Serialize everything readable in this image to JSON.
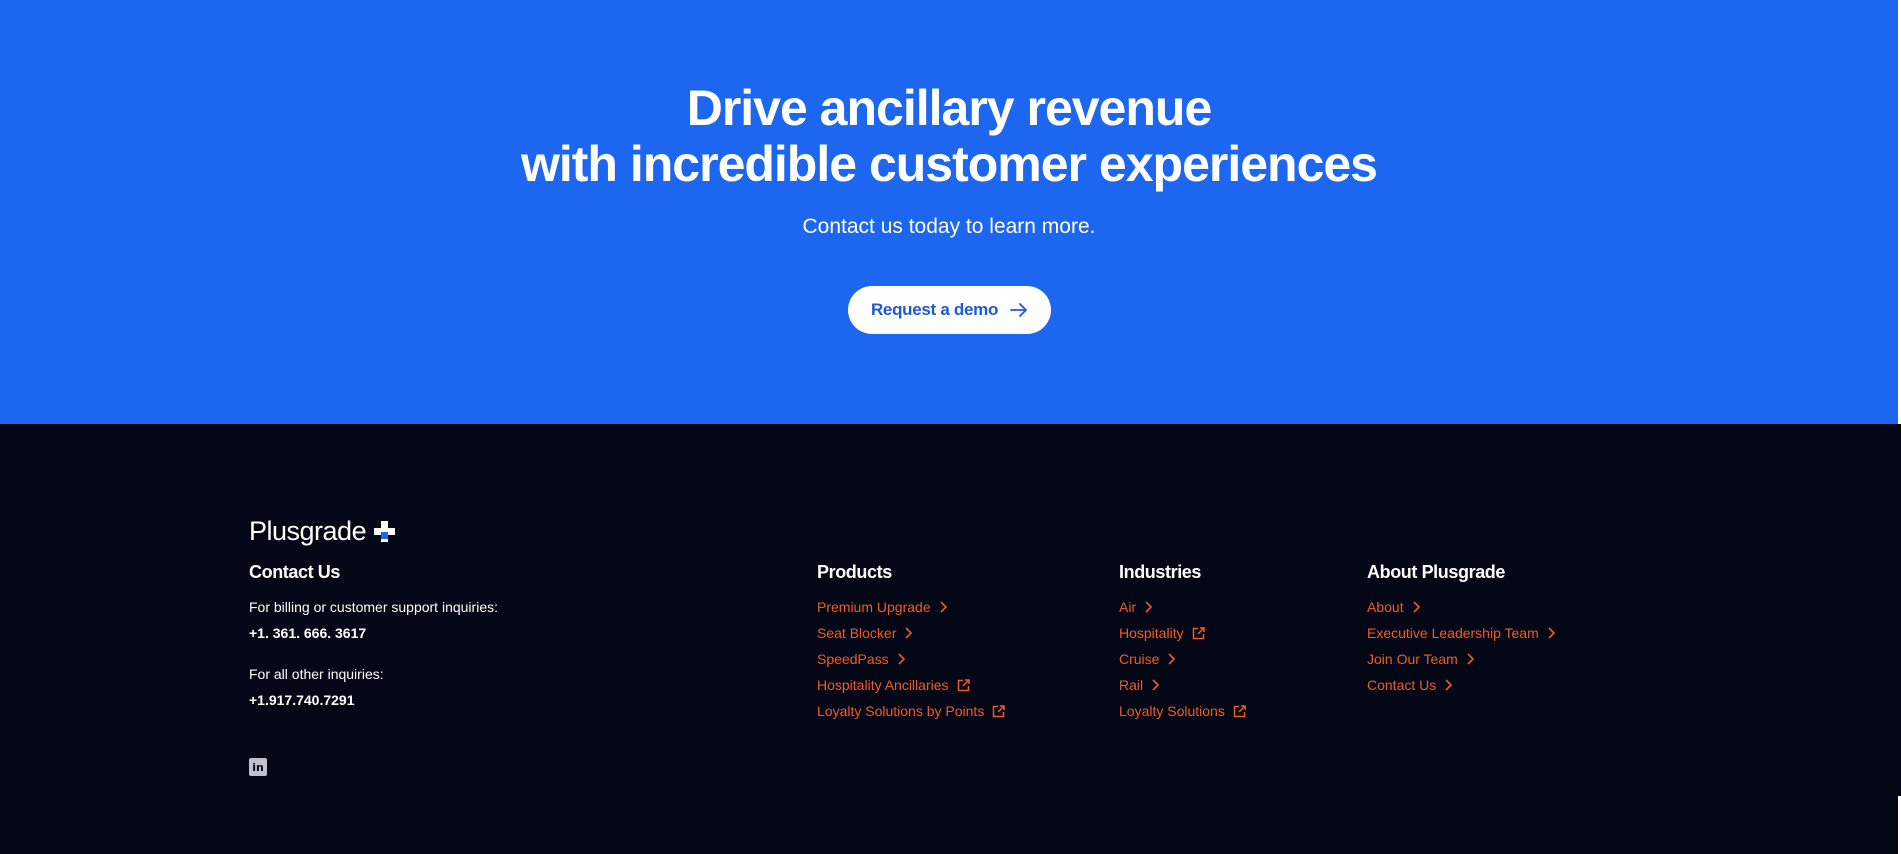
{
  "hero": {
    "title_line1": "Drive ancillary revenue",
    "title_line2": "with incredible customer experiences",
    "subtitle": "Contact us today to learn more.",
    "cta_label": "Request a demo",
    "cta_icon": "arrow-right-icon",
    "bg_color": "#1c66f0"
  },
  "footer": {
    "bg_color": "#040715",
    "link_color": "#f05a28",
    "logo_text": "Plusgrade",
    "contact": {
      "heading": "Contact Us",
      "billing_label": "For billing or customer support inquiries:",
      "billing_phone": "+1. 361. 666. 3617",
      "other_label": "For all other inquiries:",
      "other_phone": "+1.917.740.7291"
    },
    "social_icon": "linkedin-icon",
    "products": {
      "heading": "Products",
      "items": [
        {
          "label": "Premium Upgrade",
          "icon": "chevron-right-icon"
        },
        {
          "label": "Seat Blocker",
          "icon": "chevron-right-icon"
        },
        {
          "label": "SpeedPass",
          "icon": "chevron-right-icon"
        },
        {
          "label": "Hospitality Ancillaries",
          "icon": "external-link-icon"
        },
        {
          "label": "Loyalty Solutions by Points",
          "icon": "external-link-icon"
        }
      ]
    },
    "industries": {
      "heading": "Industries",
      "items": [
        {
          "label": "Air",
          "icon": "chevron-right-icon"
        },
        {
          "label": "Hospitality",
          "icon": "external-link-icon"
        },
        {
          "label": "Cruise",
          "icon": "chevron-right-icon"
        },
        {
          "label": "Rail",
          "icon": "chevron-right-icon"
        },
        {
          "label": "Loyalty Solutions",
          "icon": "external-link-icon"
        }
      ]
    },
    "about": {
      "heading": "About Plusgrade",
      "items": [
        {
          "label": "About",
          "icon": "chevron-right-icon"
        },
        {
          "label": "Executive Leadership Team",
          "icon": "chevron-right-icon"
        },
        {
          "label": "Join Our Team",
          "icon": "chevron-right-icon"
        },
        {
          "label": "Contact Us",
          "icon": "chevron-right-icon"
        }
      ]
    }
  }
}
